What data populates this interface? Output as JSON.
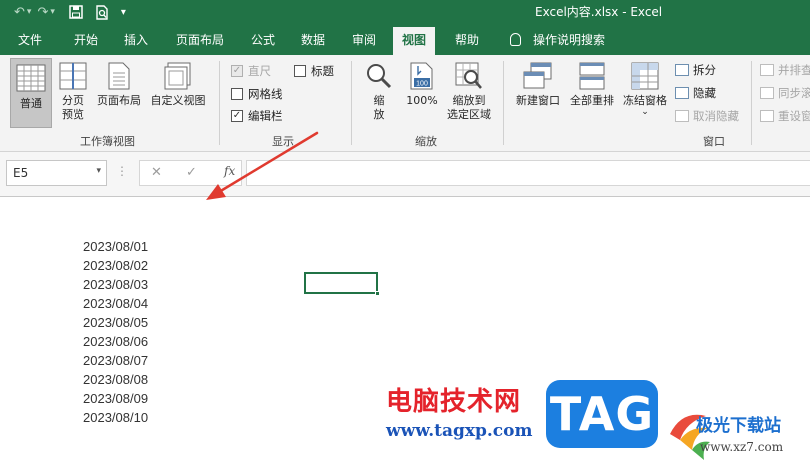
{
  "window": {
    "title": "Excel内容.xlsx  -  Excel"
  },
  "qat": {
    "undo": "↶",
    "redo": "↷",
    "dropdown": "▾"
  },
  "tabs": [
    {
      "label": "文件"
    },
    {
      "label": "开始"
    },
    {
      "label": "插入"
    },
    {
      "label": "页面布局"
    },
    {
      "label": "公式"
    },
    {
      "label": "数据"
    },
    {
      "label": "审阅"
    },
    {
      "label": "视图"
    },
    {
      "label": "帮助"
    }
  ],
  "tell_me": "操作说明搜索",
  "ribbon": {
    "workbook_views": {
      "label": "工作簿视图",
      "normal": "普通",
      "page_break_line1": "分页",
      "page_break_line2": "预览",
      "page_layout": "页面布局",
      "custom_views": "自定义视图"
    },
    "show": {
      "label": "显示",
      "ruler": "直尺",
      "gridlines": "网格线",
      "formula_bar": "编辑栏",
      "headings": "标题",
      "ruler_checked": true,
      "gridlines_checked": false,
      "formula_bar_checked": true,
      "headings_checked": false
    },
    "zoom": {
      "label": "缩放",
      "zoom_line1": "缩",
      "zoom_line2": "放",
      "zoom100": "100%",
      "zoom100_icon": "100",
      "zoom_selection_line1": "缩放到",
      "zoom_selection_line2": "选定区域"
    },
    "window": {
      "label": "窗口",
      "new_window": "新建窗口",
      "arrange_all": "全部重排",
      "freeze_panes": "冻结窗格",
      "freeze_dropdown": "⌄",
      "split": "拆分",
      "hide": "隐藏",
      "unhide": "取消隐藏",
      "side_by_side": "并排查",
      "sync_scroll": "同步滚",
      "reset_position": "重设窗"
    }
  },
  "formula_bar": {
    "name_box": "E5",
    "name_dropdown": "▾",
    "dots": "⋮",
    "cancel": "✕",
    "enter": "✓",
    "fx": "fx",
    "formula": ""
  },
  "sheet": {
    "dates": [
      "2023/08/01",
      "2023/08/02",
      "2023/08/03",
      "2023/08/04",
      "2023/08/05",
      "2023/08/06",
      "2023/08/07",
      "2023/08/08",
      "2023/08/09",
      "2023/08/10"
    ]
  },
  "watermark": {
    "brand_cn": "电脑技术网",
    "brand_url": "www.tagxp.com",
    "tag_logo": "TAG",
    "site2_cn": "极光下载站",
    "site2_url": "www.xz7.com"
  },
  "colors": {
    "excel_green": "#217346",
    "arrow_red": "#e03a2f"
  }
}
